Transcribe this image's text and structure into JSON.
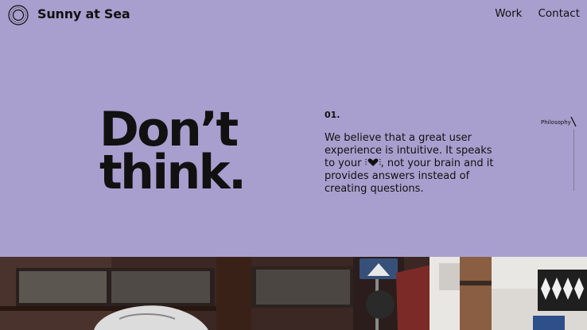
{
  "header": {
    "logo_icon": "circular-badge-logo",
    "brand": "Sunny at Sea",
    "nav": [
      {
        "label": "Work"
      },
      {
        "label": "Contact"
      }
    ]
  },
  "hero": {
    "headline_line1": "Don’t",
    "headline_line2": "think.",
    "number": "01.",
    "text_before_icon": "We believe that a great user experience is intuitive. It speaks to your",
    "icon": "heart-icon",
    "text_after_icon": ", not your brain and it provides answers instead of creating questions."
  },
  "sidebar": {
    "label": "Philosophy"
  },
  "colors": {
    "background": "#a99fce",
    "text": "#111111"
  }
}
